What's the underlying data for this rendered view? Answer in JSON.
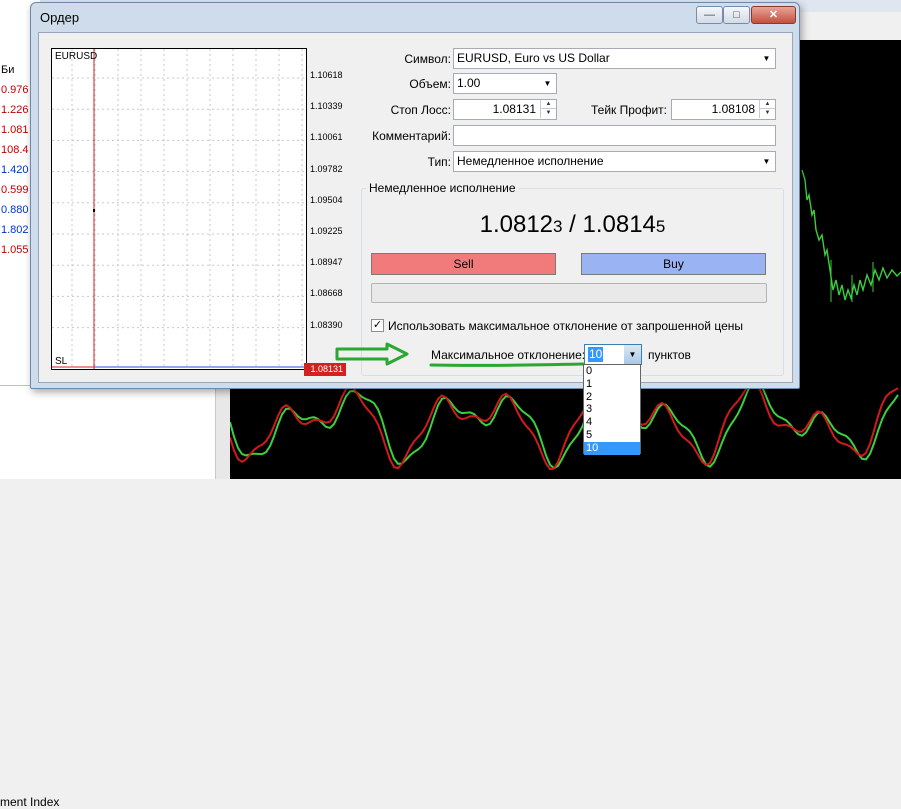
{
  "background": {
    "left_values": [
      "0.976",
      "1.226",
      "1.081",
      "108.4",
      "1.420",
      "0.599",
      "0.880",
      "1.802",
      "1.055"
    ],
    "left_value_colors": [
      "#c00000",
      "#c00000",
      "#c00000",
      "#c00000",
      "#0033cc",
      "#c00000",
      "#0033cc",
      "#0033cc",
      "#c00000"
    ],
    "header_fragment": "Би",
    "lower_panel_text": "ment Index"
  },
  "dialog": {
    "title": "Ордер",
    "window_buttons": {
      "minimize": "—",
      "maximize": "□",
      "close": "✕"
    },
    "chart": {
      "symbol": "EURUSD",
      "sl_label": "SL",
      "price_ticks": [
        "1.10618",
        "1.10339",
        "1.10061",
        "1.09782",
        "1.09504",
        "1.09225",
        "1.08947",
        "1.08668",
        "1.08390"
      ],
      "sl_price": "1.08131"
    },
    "form": {
      "symbol_label": "Символ:",
      "symbol_value": "EURUSD, Euro vs US Dollar",
      "volume_label": "Объем:",
      "volume_value": "1.00",
      "stoploss_label": "Стоп Лосс:",
      "stoploss_value": "1.08131",
      "takeprofit_label": "Тейк Профит:",
      "takeprofit_value": "1.08108",
      "comment_label": "Комментарий:",
      "comment_value": "",
      "type_label": "Тип:",
      "type_value": "Немедленное исполнение"
    },
    "execution": {
      "group_title": "Немедленное исполнение",
      "bid_main": "1.0812",
      "bid_last": "3",
      "separator": " / ",
      "ask_main": "1.0814",
      "ask_last": "5",
      "sell_label": "Sell",
      "buy_label": "Buy",
      "use_max_deviation_checked": true,
      "use_max_deviation_label": "Использовать максимальное отклонение от запрошенной цены",
      "max_deviation_label": "Максимальное отклонение:",
      "max_deviation_value": "10",
      "units_label": "пунктов",
      "deviation_options": [
        "0",
        "1",
        "2",
        "3",
        "4",
        "5",
        "10"
      ],
      "selected_option": "10"
    }
  },
  "colors": {
    "sell": "#f17b7b",
    "buy": "#9ab3f2",
    "annotation_green": "#2aa832",
    "chart_green": "#3ccf3c",
    "chart_red": "#d11a1a"
  }
}
